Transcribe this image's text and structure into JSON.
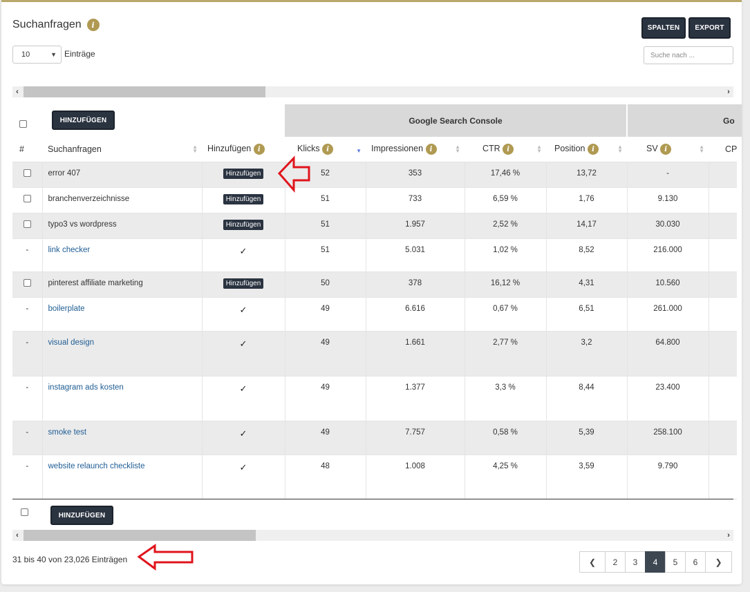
{
  "header": {
    "title": "Suchanfragen",
    "spalten_label": "SPALTEN",
    "export_label": "EXPORT"
  },
  "controls": {
    "page_size": "10",
    "entries_label": "Einträge",
    "search_placeholder": "Suche nach ..."
  },
  "bulk": {
    "add_label": "HINZUFÜGEN"
  },
  "groups": {
    "gsc": "Google Search Console",
    "next": "Go"
  },
  "columns": {
    "num": "#",
    "query": "Suchanfragen",
    "add": "Hinzufügen",
    "clicks": "Klicks",
    "impressions": "Impressionen",
    "ctr": "CTR",
    "position": "Position",
    "sv": "SV",
    "cp": "CP"
  },
  "rows": [
    {
      "selectable": true,
      "query": "error 407",
      "add": "Hinzufügen",
      "clicks": "52",
      "impressions": "353",
      "ctr": "17,46 %",
      "position": "13,72",
      "sv": "-"
    },
    {
      "selectable": true,
      "query": "branchenverzeichnisse",
      "add": "Hinzufügen",
      "clicks": "51",
      "impressions": "733",
      "ctr": "6,59 %",
      "position": "1,76",
      "sv": "9.130"
    },
    {
      "selectable": true,
      "query": "typo3 vs wordpress",
      "add": "Hinzufügen",
      "clicks": "51",
      "impressions": "1.957",
      "ctr": "2,52 %",
      "position": "14,17",
      "sv": "30.030"
    },
    {
      "selectable": false,
      "num": "-",
      "query": "link checker",
      "clicks": "51",
      "impressions": "5.031",
      "ctr": "1,02 %",
      "position": "8,52",
      "sv": "216.000"
    },
    {
      "selectable": true,
      "query": "pinterest affiliate marketing",
      "add": "Hinzufügen",
      "clicks": "50",
      "impressions": "378",
      "ctr": "16,12 %",
      "position": "4,31",
      "sv": "10.560"
    },
    {
      "selectable": false,
      "num": "-",
      "query": "boilerplate",
      "clicks": "49",
      "impressions": "6.616",
      "ctr": "0,67 %",
      "position": "6,51",
      "sv": "261.000"
    },
    {
      "selectable": false,
      "num": "-",
      "query": "visual design",
      "clicks": "49",
      "impressions": "1.661",
      "ctr": "2,77 %",
      "position": "3,2",
      "sv": "64.800"
    },
    {
      "selectable": false,
      "num": "-",
      "query": "instagram ads kosten",
      "clicks": "49",
      "impressions": "1.377",
      "ctr": "3,3 %",
      "position": "8,44",
      "sv": "23.400"
    },
    {
      "selectable": false,
      "num": "-",
      "query": "smoke test",
      "clicks": "49",
      "impressions": "7.757",
      "ctr": "0,58 %",
      "position": "5,39",
      "sv": "258.100"
    },
    {
      "selectable": false,
      "num": "-",
      "query": "website relaunch checkliste",
      "clicks": "48",
      "impressions": "1.008",
      "ctr": "4,25 %",
      "position": "3,59",
      "sv": "9.790"
    }
  ],
  "footer": {
    "summary": "31 bis 40 von 23,026 Einträgen"
  },
  "pagination": {
    "pages": [
      "2",
      "3",
      "4",
      "5",
      "6"
    ],
    "current": "4"
  },
  "colors": {
    "accent": "#b09a52",
    "dark": "#2a3340",
    "link": "#1f5d94",
    "annotation": "#e0141c"
  }
}
